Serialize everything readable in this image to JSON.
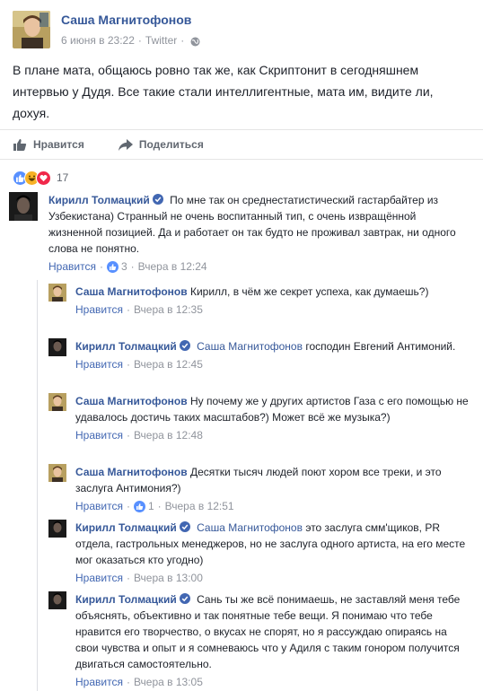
{
  "post": {
    "author": "Саша Магнитофонов",
    "date": "6 июня в 23:22",
    "source": "Twitter",
    "text": "В плане мата, общаюсь ровно так же, как Скриптонит в сегодняшнем интервью у Дудя. Все такие стали интеллигентные, мата им, видите ли, дохуя."
  },
  "actions": {
    "like_label": "Нравится",
    "share_label": "Поделиться"
  },
  "reactions": {
    "count": "17",
    "icons": [
      "like-reaction-icon",
      "haha-reaction-icon",
      "love-reaction-icon"
    ]
  },
  "colors": {
    "link": "#365899",
    "like_blue": "#4267b2",
    "muted": "#90949c",
    "love_red": "#f0284a",
    "haha_yellow": "#f7b125"
  },
  "comments": [
    {
      "author": "Кирилл Толмацкий",
      "verified": true,
      "text": "По мне так он среднестатистический гастарбайтер из Узбекистана) Странный не очень воспитанный тип, с очень извращённой жизненной позицией. Да и работает он так будто не проживал завтрак, ни одного слова не понятно.",
      "like_label": "Нравится",
      "likes": "3",
      "time": "Вчера в 12:24"
    },
    {
      "author": "Саша Магнитофонов",
      "verified": false,
      "text": "Кирилл, в чём же секрет успеха, как думаешь?)",
      "like_label": "Нравится",
      "time": "Вчера в 12:35"
    },
    {
      "author": "Кирилл Толмацкий",
      "verified": true,
      "mention": "Саша Магнитофонов",
      "text": "господин Евгений Антимоний.",
      "like_label": "Нравится",
      "time": "Вчера в 12:45"
    },
    {
      "author": "Саша Магнитофонов",
      "verified": false,
      "text": "Ну почему же у других артистов Газа с его помощью не удавалось достичь таких масштабов?) Может всё же музыка?)",
      "like_label": "Нравится",
      "time": "Вчера в 12:48"
    },
    {
      "author": "Саша Магнитофонов",
      "verified": false,
      "text": "Десятки тысяч людей поют хором все треки, и это заслуга Антимония?)",
      "like_label": "Нравится",
      "likes": "1",
      "time": "Вчера в 12:51"
    },
    {
      "author": "Кирилл Толмацкий",
      "verified": true,
      "mention": "Саша Магнитофонов",
      "text": "это заслуга смм'щиков, PR отдела, гастрольных менеджеров, но не заслуга одного артиста, на его месте мог оказаться кто угодно)",
      "like_label": "Нравится",
      "time": "Вчера в 13:00"
    },
    {
      "author": "Кирилл Толмацкий",
      "verified": true,
      "text": "Сань ты же всё понимаешь, не заставляй меня тебе объяснять, объективно и так понятные тебе вещи. Я понимаю что тебе нравится его творчество, о вкусах не спорят, но я рассуждаю опираясь на свои чувства и опыт и я сомневаюсь что у Адиля с таким гонором получится двигаться самостоятельно.",
      "like_label": "Нравится",
      "time": "Вчера в 13:05"
    }
  ]
}
